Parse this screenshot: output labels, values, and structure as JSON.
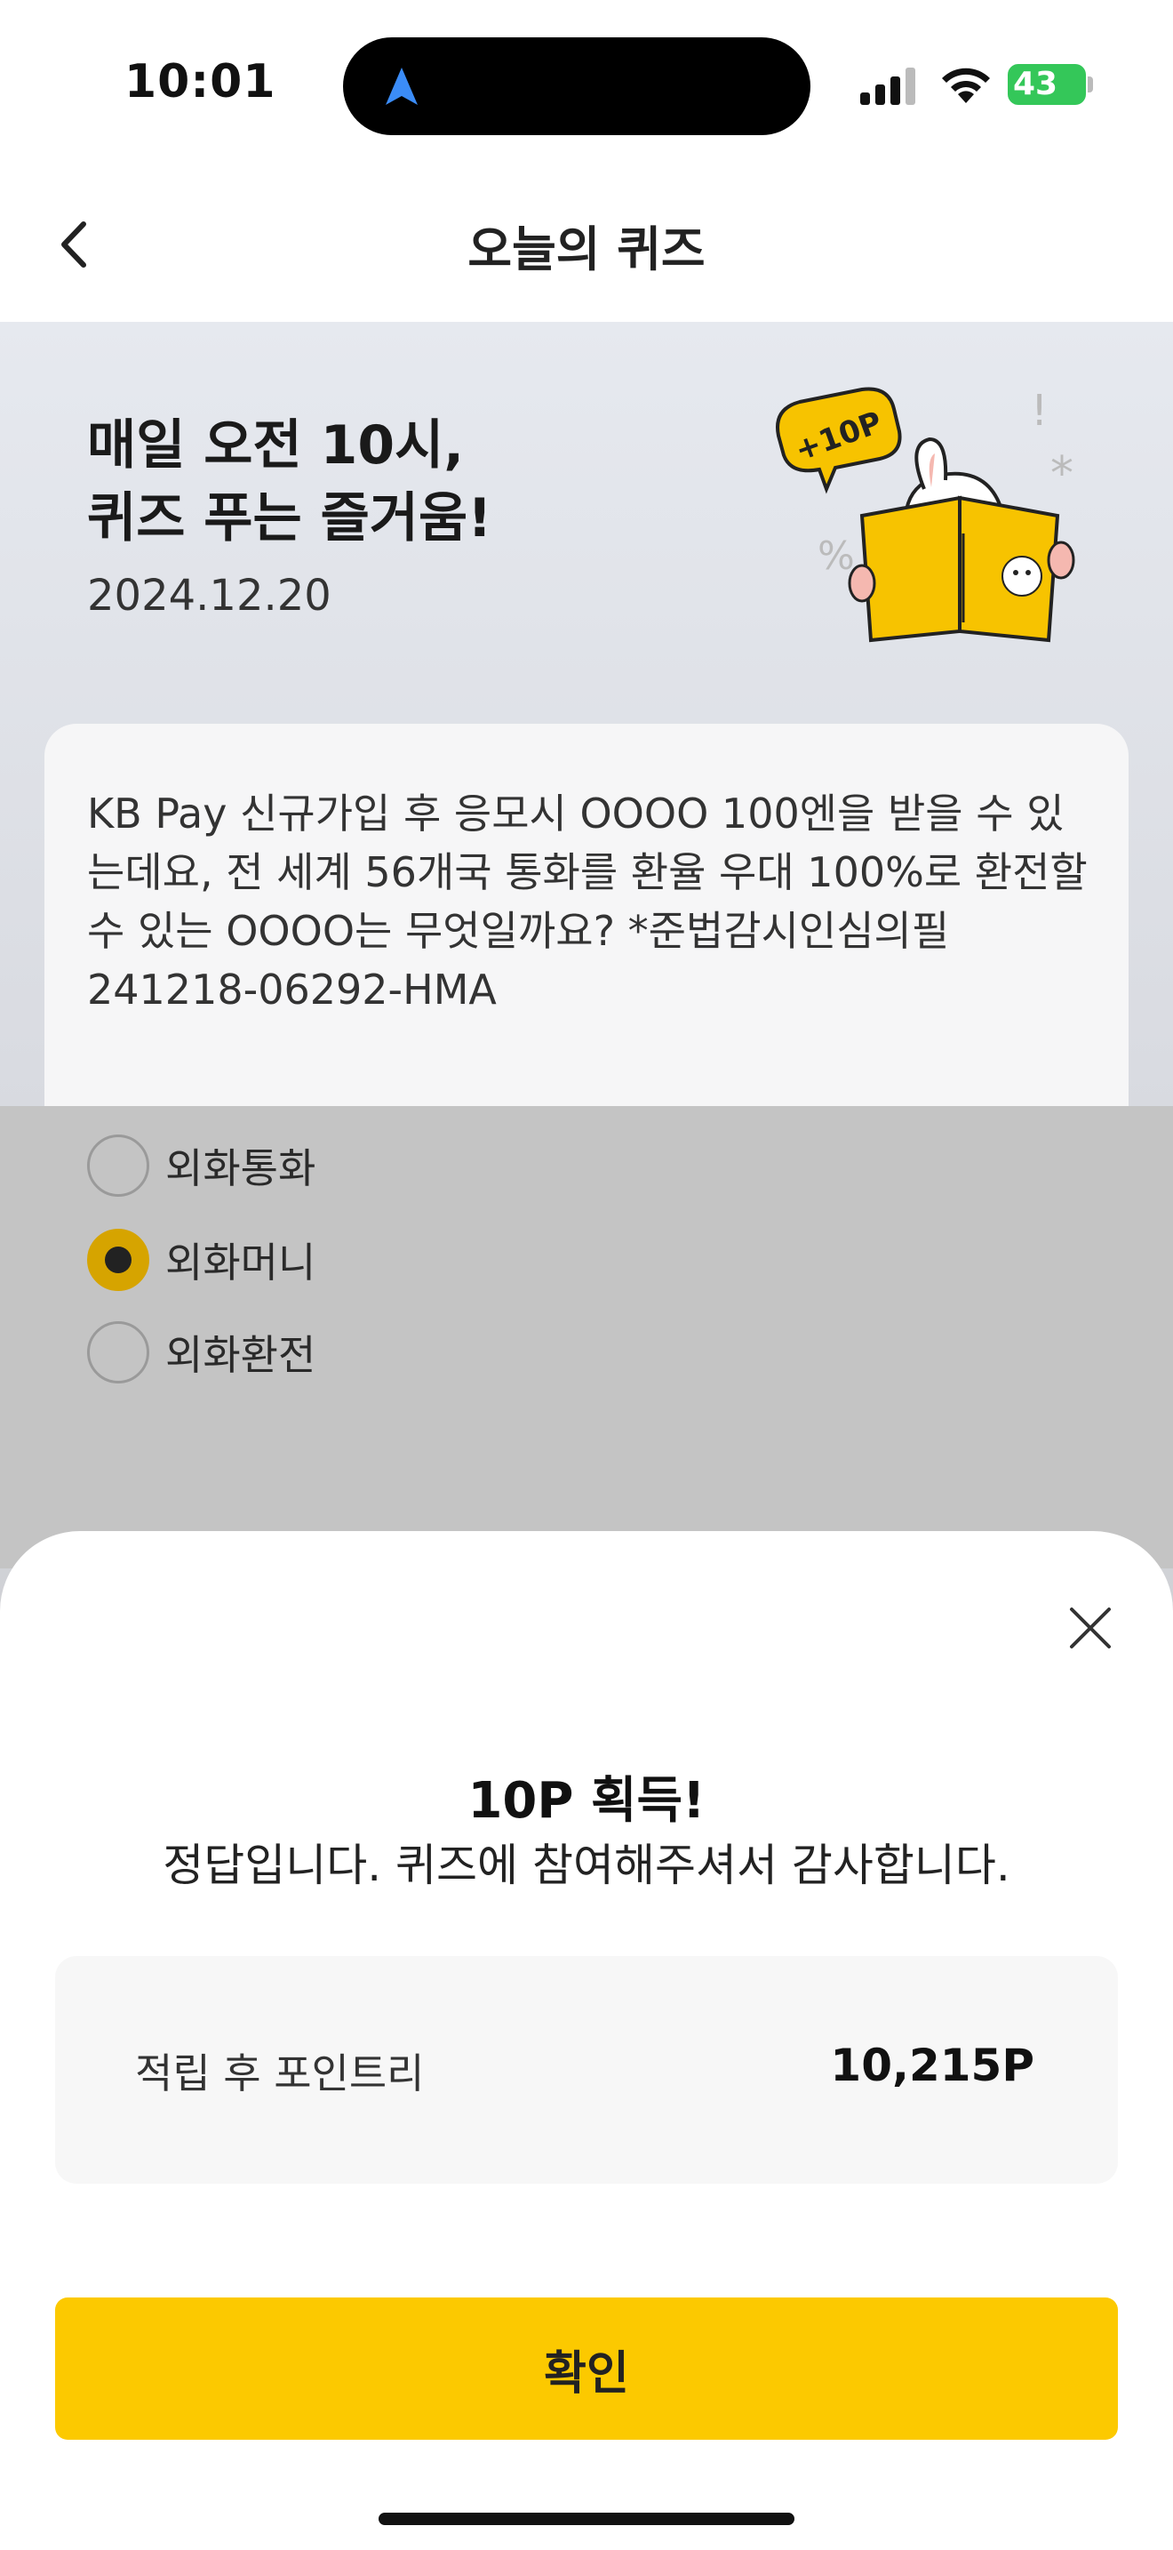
{
  "status_bar": {
    "time": "10:01",
    "battery": "43"
  },
  "header": {
    "title": "오늘의 퀴즈"
  },
  "hero": {
    "title_line1": "매일 오전 10시,",
    "title_line2": "퀴즈 푸는 즐거움!",
    "date": "2024.12.20",
    "badge": "+10P"
  },
  "quiz": {
    "question": "KB Pay 신규가입 후 응모시 OOOO 100엔을 받을 수 있는데요, 전 세계 56개국 통화를 환율 우대 100%로 환전할 수 있는 OOOO는 무엇일까요? *준법감시인심의필 241218-06292-HMA",
    "options": [
      {
        "label": "외화통화",
        "selected": false
      },
      {
        "label": "외화머니",
        "selected": true
      },
      {
        "label": "외화환전",
        "selected": false
      }
    ]
  },
  "sheet": {
    "title": "10P 획득!",
    "message": "정답입니다. 퀴즈에 참여해주셔서 감사합니다.",
    "points_label": "적립 후 포인트리",
    "points_value": "10,215P",
    "confirm_label": "확인"
  },
  "colors": {
    "accent": "#fcc900",
    "radio_selected": "#d6a400"
  },
  "icons": [
    "location-arrow-icon",
    "signal-icon",
    "wifi-icon",
    "battery-icon",
    "back-chevron-icon",
    "close-icon"
  ]
}
